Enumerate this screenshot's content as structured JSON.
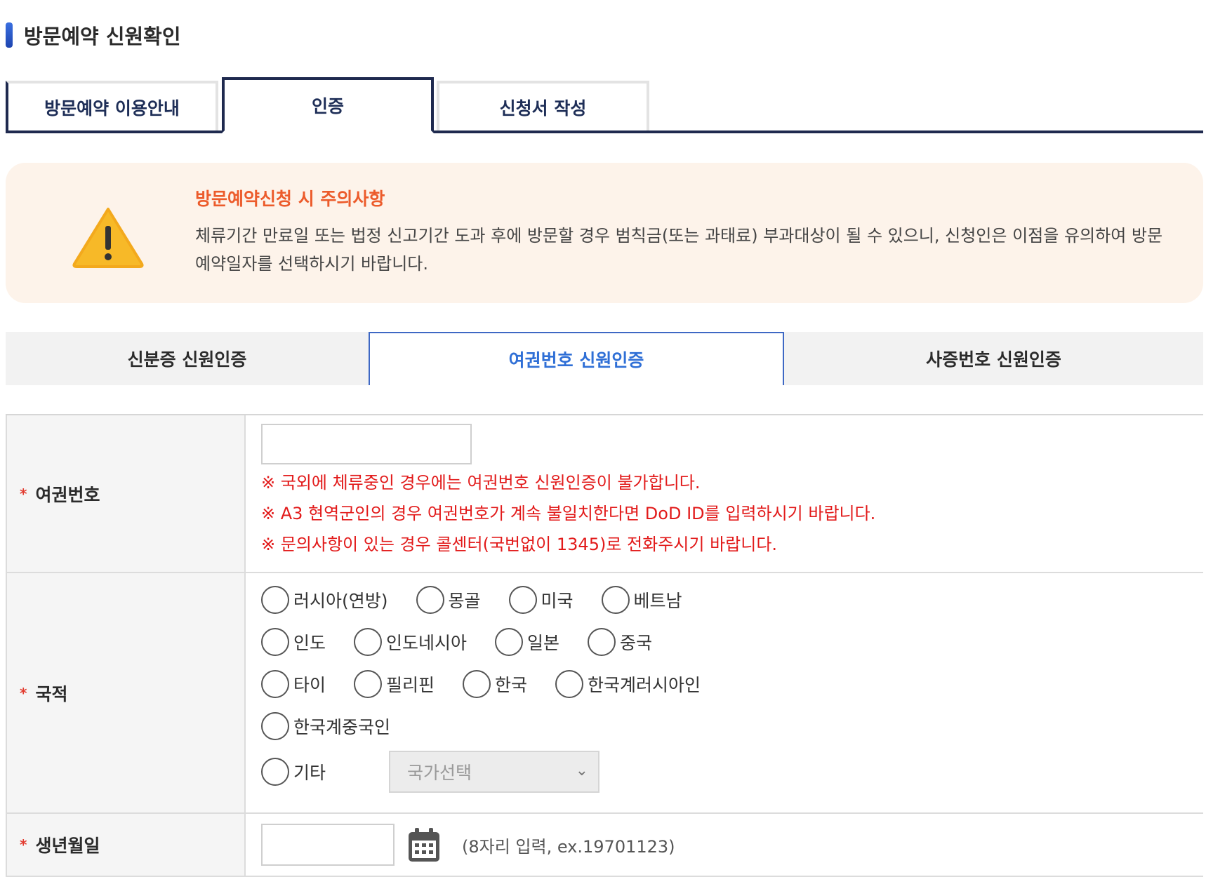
{
  "page": {
    "title": "방문예약 신원확인"
  },
  "steps": [
    {
      "label": "방문예약 이용안내"
    },
    {
      "label": "인증"
    },
    {
      "label": "신청서 작성"
    }
  ],
  "notice": {
    "title": "방문예약신청 시 주의사항",
    "body": "체류기간 만료일 또는 법정 신고기간 도과 후에 방문할 경우 범칙금(또는 과태료) 부과대상이 될 수 있으니, 신청인은 이점을 유의하여 방문예약일자를 선택하시기 바랍니다.",
    "icon": "warning-icon"
  },
  "auth_tabs": [
    {
      "label": "신분증 신원인증"
    },
    {
      "label": "여권번호 신원인증"
    },
    {
      "label": "사증번호 신원인증"
    }
  ],
  "form": {
    "passport": {
      "label": "여권번호",
      "required_mark": "*",
      "value": "",
      "warnings": [
        "※ 국외에 체류중인 경우에는 여권번호 신원인증이 불가합니다.",
        "※ A3 현역군인의 경우 여권번호가 계속 불일치한다면 DoD ID를 입력하시기 바랍니다.",
        "※ 문의사항이 있는 경우 콜센터(국번없이 1345)로 전화주시기 바랍니다."
      ]
    },
    "nationality": {
      "label": "국적",
      "required_mark": "*",
      "options": [
        "러시아(연방)",
        "몽골",
        "미국",
        "베트남",
        "인도",
        "인도네시아",
        "일본",
        "중국",
        "타이",
        "필리핀",
        "한국",
        "한국계러시아인",
        "한국계중국인"
      ],
      "other_label": "기타",
      "select_placeholder": "국가선택"
    },
    "birth": {
      "label": "생년월일",
      "required_mark": "*",
      "value": "",
      "hint": "(8자리 입력, ex.19701123)"
    }
  },
  "colors": {
    "accent_navy": "#1f2a4f",
    "notice_title": "#ec5b2b",
    "warning_text": "#e21a1a",
    "active_tab": "#2f6fd6",
    "notice_bg": "#fdf3ea"
  }
}
